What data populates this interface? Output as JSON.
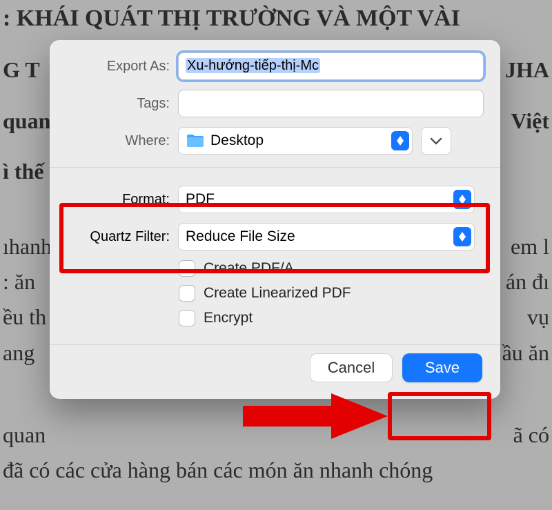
{
  "background": {
    "title_line": ": KHÁI QUÁT THỊ TRƯỜNG VÀ MỘT VÀI",
    "line2_left": "G T",
    "line2_right": "JHA",
    "line3_left": "quan",
    "line3_right": "Việt",
    "line4_left": "ì thế",
    "para_left_1": "ıhanh",
    "para_right_1": "em l",
    "para_left_2": ": ăn",
    "para_right_2": "án đı",
    "para_left_3": "ều th",
    "para_right_3": "vụ",
    "para_left_4": "ang",
    "para_right_4": "ầu ăn",
    "line_bottom1_left": "quan",
    "line_bottom1_right": "ã có",
    "line_bottom2": "đã có các cửa hàng bán các món ăn nhanh chóng"
  },
  "dialog": {
    "exportAs": {
      "label": "Export As:",
      "value": "Xu-hướng-tiếp-thị-Mc"
    },
    "tags": {
      "label": "Tags:"
    },
    "where": {
      "label": "Where:",
      "value": "Desktop"
    },
    "format": {
      "label": "Format:",
      "value": "PDF"
    },
    "quartz": {
      "label": "Quartz Filter:",
      "value": "Reduce File Size"
    },
    "checkboxes": {
      "pdfA": "Create PDF/A",
      "linear": "Create Linearized PDF",
      "encrypt": "Encrypt"
    },
    "buttons": {
      "cancel": "Cancel",
      "save": "Save"
    }
  }
}
